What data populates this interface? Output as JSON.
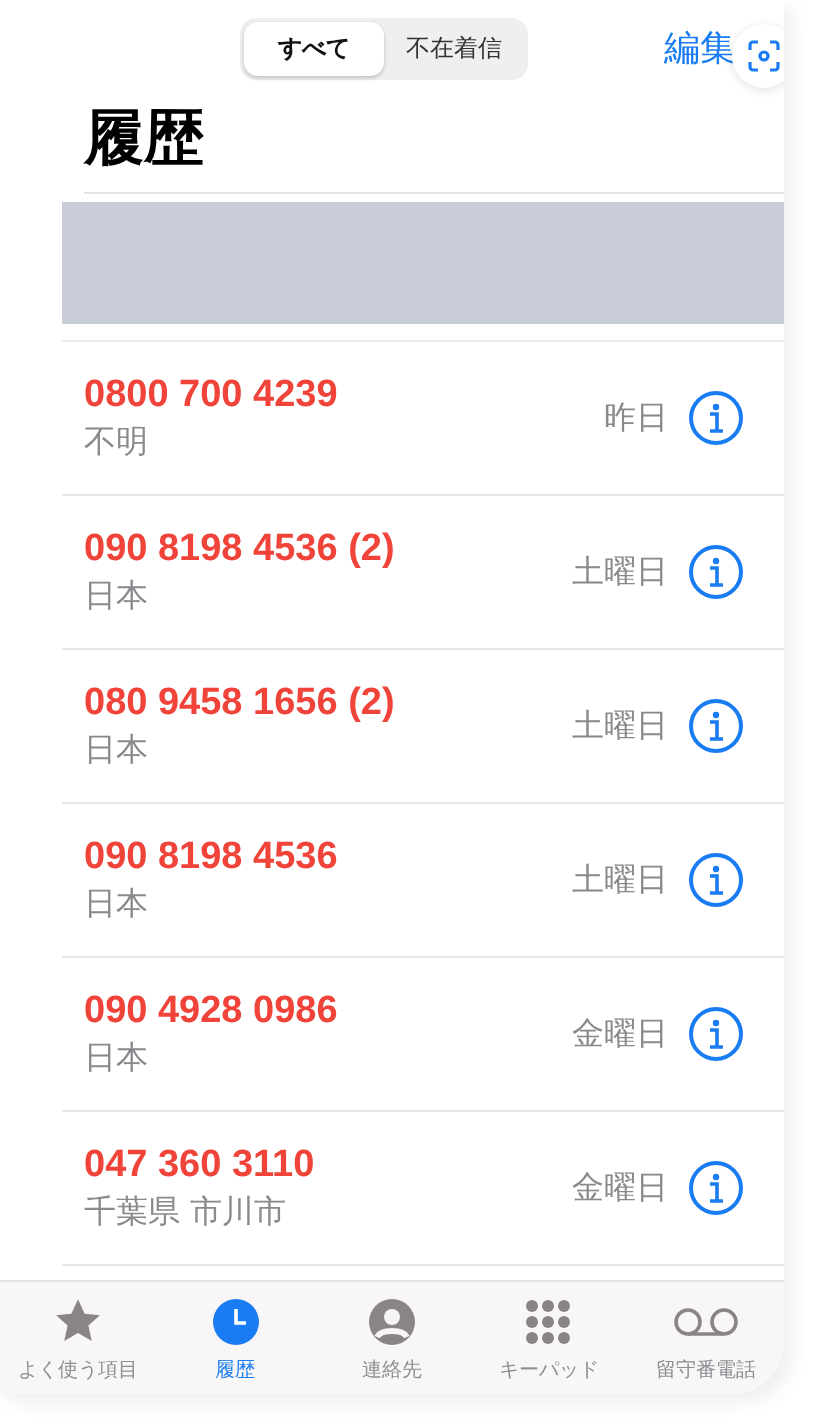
{
  "segments": [
    {
      "label": "すべて",
      "selected": true
    },
    {
      "label": "不在着信",
      "selected": false
    }
  ],
  "edit_button": "編集",
  "title": "履歴",
  "calls": [
    {
      "number": "0800 700 4239",
      "place": "不明",
      "when": "昨日",
      "missed": true
    },
    {
      "number": "090 8198 4536 (2)",
      "place": "日本",
      "when": "土曜日",
      "missed": true
    },
    {
      "number": "080 9458 1656 (2)",
      "place": "日本",
      "when": "土曜日",
      "missed": true
    },
    {
      "number": "090 8198 4536",
      "place": "日本",
      "when": "土曜日",
      "missed": true
    },
    {
      "number": "090 4928 0986",
      "place": "日本",
      "when": "金曜日",
      "missed": true
    },
    {
      "number": "047 360 3110",
      "place": "千葉県 市川市",
      "when": "金曜日",
      "missed": true
    }
  ],
  "tab_bar": [
    {
      "label": "よく使う項目",
      "kind": "star",
      "selected": false
    },
    {
      "label": "履歴",
      "kind": "clock",
      "selected": true
    },
    {
      "label": "連絡先",
      "kind": "person",
      "selected": false
    },
    {
      "label": "キーパッド",
      "kind": "keypad",
      "selected": false
    },
    {
      "label": "留守番電話",
      "kind": "voicemail",
      "selected": false
    }
  ]
}
